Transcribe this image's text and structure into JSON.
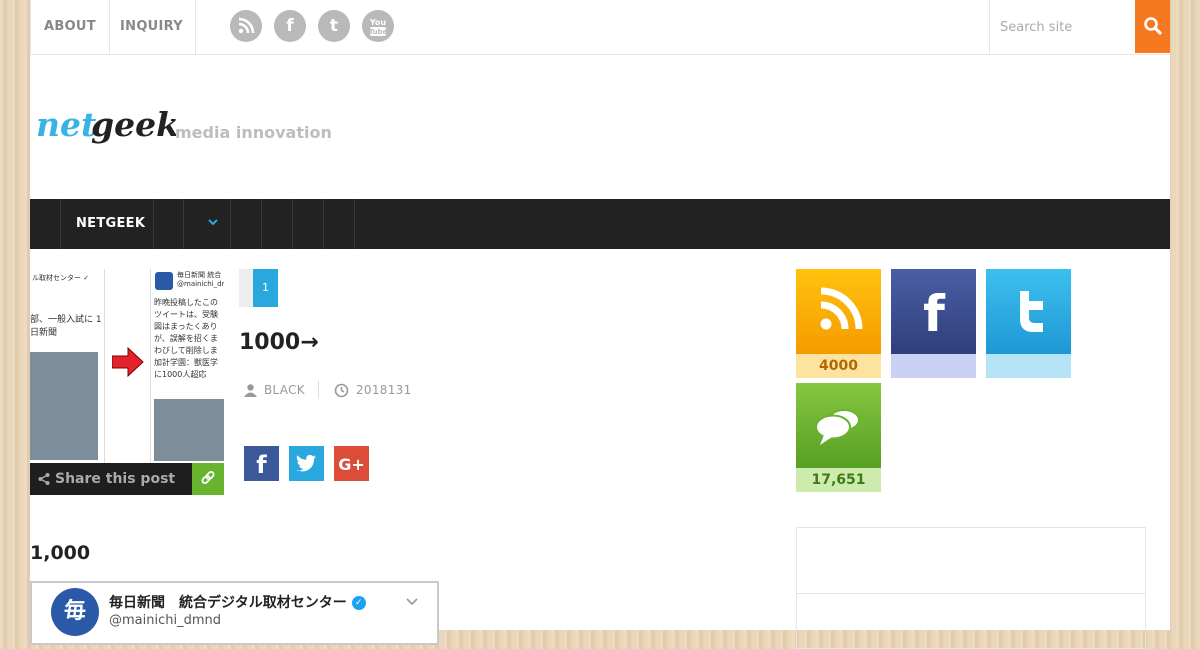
{
  "topbar": {
    "links": [
      "ABOUT",
      "INQUIRY"
    ],
    "social_icons": [
      "rss-icon",
      "facebook-icon",
      "twitter-icon",
      "youtube-icon"
    ],
    "search_placeholder": "Search site"
  },
  "header": {
    "logo_text": "netgeek",
    "tagline": "media innovation"
  },
  "nav": {
    "items": [
      "NETGEEK"
    ]
  },
  "thumbnail": {
    "share_label": "Share this post"
  },
  "post": {
    "page": "1",
    "title": "1000→",
    "author": "BLACK",
    "date": "2018131",
    "share_buttons": [
      "facebook",
      "twitter",
      "google-plus"
    ]
  },
  "content": {
    "heading": "1,000",
    "embed_name": "毎日新聞　統合デジタル取材センター",
    "embed_handle": "@mainichi_dmnd"
  },
  "sidebar": {
    "tiles": [
      {
        "icon": "rss-icon",
        "count": "4000",
        "color": "#f7a600"
      },
      {
        "icon": "facebook-icon",
        "count": "",
        "color": "#3b4d91"
      },
      {
        "icon": "twitter-icon",
        "count": "",
        "color": "#29a8e0"
      },
      {
        "icon": "comments-icon",
        "count": "17,651",
        "color": "#69b42e"
      }
    ]
  },
  "colors": {
    "accent_orange": "#f47920",
    "nav_dark": "#222222",
    "accent_blue": "#29a8e0"
  }
}
